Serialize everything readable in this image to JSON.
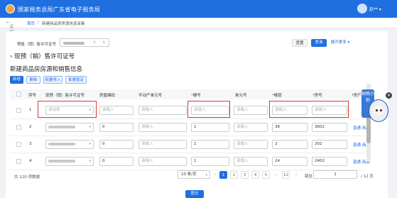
{
  "header": {
    "title": "国家税务总局广东省电子税务局",
    "user_name": "赵**"
  },
  "breadcrumb": {
    "back": "返回",
    "home": "首页",
    "sep": "/",
    "current": "新建商品房房源信息采集"
  },
  "filter": {
    "label": "预售（销）售许可证号",
    "reset": "查置",
    "query": "查询",
    "more": "展开更多"
  },
  "section_permit": {
    "arrow": "›",
    "title": "现预（销）售许可证号"
  },
  "section_main": {
    "title": "新建商品房房源和销售信息"
  },
  "toolbar": {
    "add": "新增",
    "delete": "删除",
    "import": "批量导入",
    "lock": "批量锁定"
  },
  "table": {
    "columns": {
      "index": "序号",
      "permit": "现预（销）售许可证号",
      "building_code": "房屋编码",
      "property_unit": "不动产单元号",
      "building_no": "楼号",
      "unit_no": "单元号",
      "floor": "楼层",
      "room_no": "房号",
      "op_prefix": "*房产",
      "op_suffix": "性"
    },
    "placeholder_select": "请选择",
    "placeholder_input": "请输入",
    "rows": [
      {
        "n": "1",
        "permit": "",
        "building_code": "",
        "property_unit": "",
        "building_no": "",
        "unit_no": "",
        "floor": "",
        "room_no": "",
        "op1": "",
        "op2": ""
      },
      {
        "n": "2",
        "permit": "blur",
        "building_code": "0",
        "property_unit": "",
        "building_no": "1",
        "unit_no": "",
        "floor": "36",
        "room_no": "3602",
        "op1": "普通",
        "op2": "商品"
      },
      {
        "n": "3",
        "permit": "blur",
        "building_code": "0",
        "property_unit": "",
        "building_no": "1",
        "unit_no": "",
        "floor": "2",
        "room_no": "202",
        "op1": "普通",
        "op2": "商品"
      },
      {
        "n": "4",
        "permit": "blur",
        "building_code": "0",
        "property_unit": "",
        "building_no": "1",
        "unit_no": "",
        "floor": "24",
        "room_no": "2402",
        "op1": "普通",
        "op2": "商品"
      }
    ]
  },
  "helper": {
    "bubble": "纳税小助"
  },
  "pagination": {
    "total": "共 120 项数据",
    "page_size": "10 条/页",
    "prev": "‹",
    "pages": [
      "1",
      "2",
      "3",
      "4",
      "5",
      "...",
      "12"
    ],
    "next": "›",
    "goto_label": "跳至",
    "goto_value": "1",
    "goto_total": "/ 12 页"
  },
  "submit": "提交"
}
